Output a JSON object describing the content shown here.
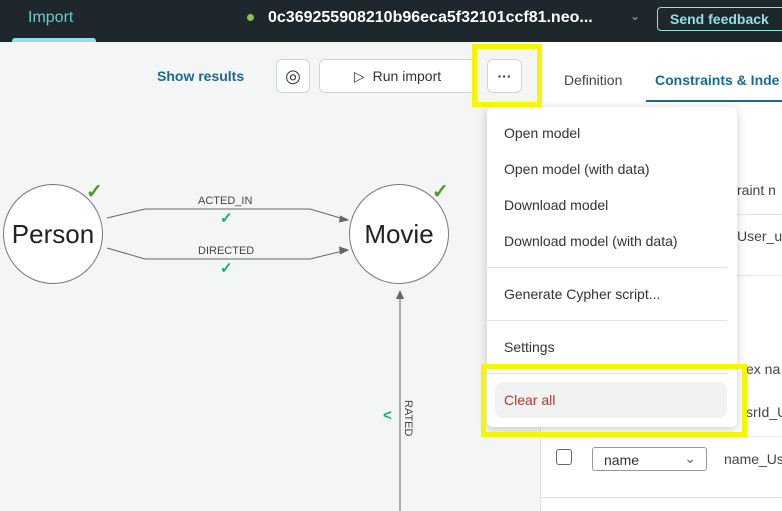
{
  "header": {
    "tab": "Import",
    "database": "0c369255908210b96eca5f32101ccf81.neo...",
    "feedback": "Send feedback",
    "status_color": "#8bc34a"
  },
  "toolbar": {
    "show_results": "Show results",
    "run_import": "Run import",
    "more": "···"
  },
  "panel": {
    "tabs": [
      "Definition",
      "Constraints & Inde"
    ],
    "constraint_header": "raint n",
    "constraint_value": "User_u",
    "index_header": "ex na",
    "index_value": "srId_U",
    "row_select": "name",
    "row_value": "name_Us"
  },
  "menu": {
    "items": [
      "Open model",
      "Open model (with data)",
      "Download model",
      "Download model (with data)",
      "Generate Cypher script...",
      "Settings",
      "Clear all"
    ]
  },
  "graph": {
    "nodes": [
      "Person",
      "Movie"
    ],
    "relationships": [
      "ACTED_IN",
      "DIRECTED",
      "RATED"
    ]
  }
}
